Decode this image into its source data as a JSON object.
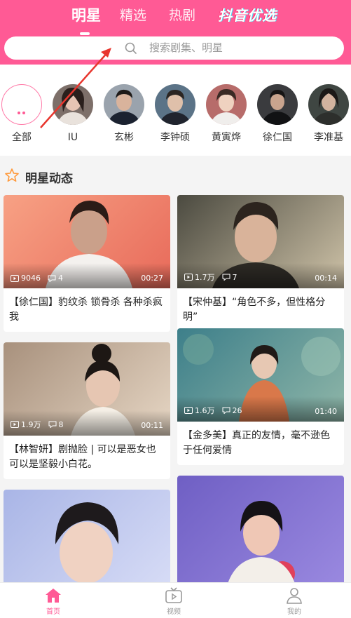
{
  "header": {
    "tabs": [
      {
        "label": "明星",
        "active": true
      },
      {
        "label": "精选",
        "active": false
      },
      {
        "label": "热剧",
        "active": false
      },
      {
        "label": "抖音优选",
        "active": false
      }
    ],
    "accent": "#ff5a95"
  },
  "search": {
    "placeholder": "搜索剧集、明星"
  },
  "stars": [
    {
      "name": "全部",
      "icon": "more-dots-icon"
    },
    {
      "name": "IU"
    },
    {
      "name": "玄彬"
    },
    {
      "name": "李钟硕"
    },
    {
      "name": "黄寅烨"
    },
    {
      "name": "徐仁国"
    },
    {
      "name": "李准基"
    }
  ],
  "section": {
    "title": "明星动态",
    "icon": "star-outline-icon"
  },
  "cards": [
    {
      "views": "9046",
      "comments": "4",
      "duration": "00:27",
      "caption": "【徐仁国】豹纹杀 锁骨杀 各种杀疯我"
    },
    {
      "views": "1.7万",
      "comments": "7",
      "duration": "00:14",
      "caption": "【宋仲基】“角色不多，但性格分明”"
    },
    {
      "views": "1.9万",
      "comments": "8",
      "duration": "00:11",
      "caption": "【林智妍】剧抛脸 | 可以是恶女也可以是坚毅小白花。"
    },
    {
      "views": "1.6万",
      "comments": "26",
      "duration": "01:40",
      "caption": "【金多美】真正的友情，毫不逊色于任何爱情"
    },
    {
      "caption": ""
    },
    {
      "caption": ""
    }
  ],
  "bottom_nav": [
    {
      "label": "首页",
      "icon": "home-icon",
      "active": true
    },
    {
      "label": "视频",
      "icon": "tv-icon",
      "active": false
    },
    {
      "label": "我的",
      "icon": "user-icon",
      "active": false
    }
  ]
}
